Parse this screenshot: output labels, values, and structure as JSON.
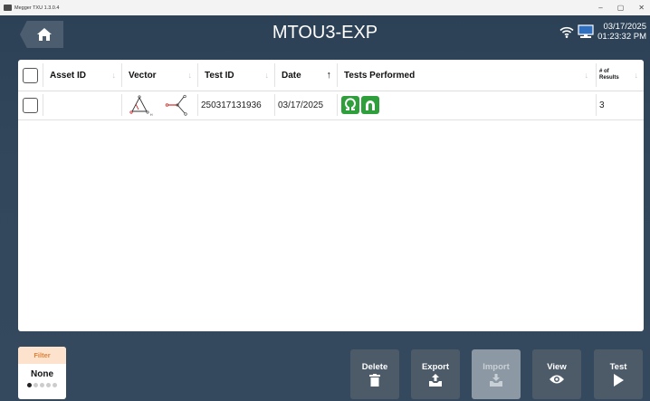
{
  "window": {
    "title": "Megger TXU 1.3.0.4",
    "controls": {
      "minimize": "–",
      "maximize": "▢",
      "close": "✕"
    }
  },
  "header": {
    "title": "MTOU3-EXP",
    "date": "03/17/2025",
    "time": "01:23:32 PM",
    "icons": [
      "home-icon",
      "wifi-icon",
      "computer-icon"
    ]
  },
  "table": {
    "columns": [
      {
        "label": "Asset ID",
        "sort": "↓"
      },
      {
        "label": "Vector",
        "sort": "↓"
      },
      {
        "label": "Test ID",
        "sort": "↓"
      },
      {
        "label": "Date",
        "sort": "↑"
      },
      {
        "label": "Tests Performed",
        "sort": "↓"
      },
      {
        "label": "# of Results",
        "sort": "↓"
      }
    ],
    "rows": [
      {
        "asset_id": "",
        "vector_icons": [
          "delta-vector-icon",
          "wye-vector-icon"
        ],
        "test_id": "250317131936",
        "date": "03/17/2025",
        "tests_icons": [
          "winding-resistance-icon",
          "demagnetization-icon"
        ],
        "results": "3"
      }
    ]
  },
  "footer": {
    "filter": {
      "label": "Filter",
      "value": "None",
      "page_indicator": {
        "current": 1,
        "total": 5
      }
    },
    "buttons": [
      {
        "label": "Delete",
        "icon": "trash-icon",
        "enabled": true
      },
      {
        "label": "Export",
        "icon": "export-icon",
        "enabled": true
      },
      {
        "label": "Import",
        "icon": "import-icon",
        "enabled": false
      },
      {
        "label": "View",
        "icon": "eye-icon",
        "enabled": true
      },
      {
        "label": "Test",
        "icon": "play-icon",
        "enabled": true
      }
    ]
  },
  "colors": {
    "accent_green": "#2e9f3b",
    "filter_orange": "#e0803a",
    "header_bg": "#2c4156",
    "button_bg": "#4d5b69"
  }
}
